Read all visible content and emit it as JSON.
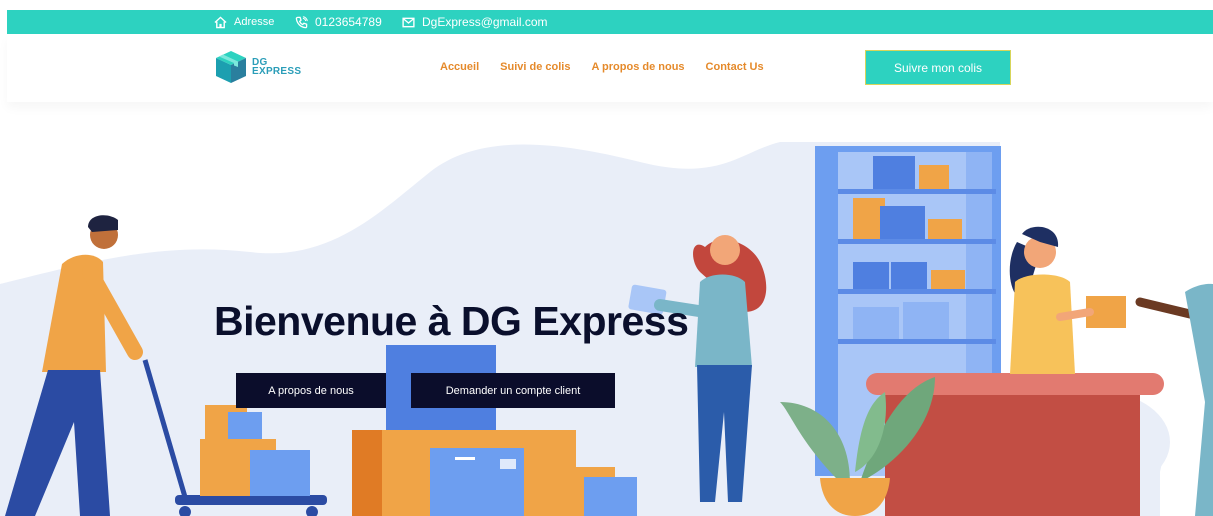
{
  "topbar": {
    "address": "Adresse",
    "phone": "0123654789",
    "email": "DgExpress@gmail.com"
  },
  "header": {
    "logo": {
      "line1": "DG",
      "line2": "EXPRESS"
    },
    "nav": [
      "Accueil",
      "Suivi de colis",
      "A propos de nous",
      "Contact Us"
    ],
    "cta": "Suivre mon colis"
  },
  "hero": {
    "title": "Bienvenue à DG Express",
    "buttons": [
      "A propos de nous",
      "Demander un compte client"
    ]
  },
  "colors": {
    "accent": "#2dd2c0",
    "nav": "#e58a2b",
    "dark": "#0b0d2b"
  }
}
